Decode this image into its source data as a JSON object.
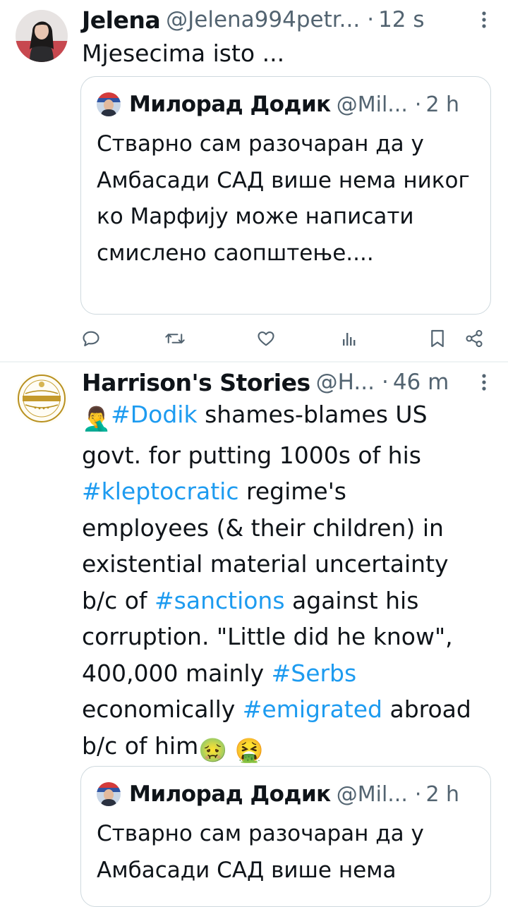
{
  "tweets": [
    {
      "author_name": "Jelena",
      "author_handle": "@Jelena994petr...",
      "time": "12 s",
      "text": "Mjesecima isto ...",
      "quote": {
        "author_name": "Милорад Додик",
        "author_handle": "@Mil...",
        "time": "2 h",
        "text": "Стварно сам разочаран да у Амбасади САД више нема никог ко Марфију може написати смислено саопштење...."
      }
    },
    {
      "author_name": "Harrison's Stories",
      "author_handle": "@H...",
      "time": "46 m",
      "text_segments": [
        {
          "t": "🤦‍♂️",
          "emoji": true
        },
        {
          "t": "#Dodik",
          "tag": true
        },
        {
          "t": " shames-blames US govt. for putting 1000s of his "
        },
        {
          "t": "#kleptocratic",
          "tag": true
        },
        {
          "t": " regime's employees (& their children) in existential material uncertainty b/c of "
        },
        {
          "t": "#sanctions",
          "tag": true
        },
        {
          "t": " against his corruption. \"Little did he know\", 400,000 mainly "
        },
        {
          "t": "#Serbs",
          "tag": true
        },
        {
          "t": " economically "
        },
        {
          "t": "#emigrated",
          "tag": true
        },
        {
          "t": " abroad b/c of him"
        },
        {
          "t": "🤢",
          "emoji": true
        },
        {
          "t": " "
        },
        {
          "t": "🤮",
          "emoji": true
        }
      ],
      "quote": {
        "author_name": "Милорад Додик",
        "author_handle": "@Mil...",
        "time": "2 h",
        "text": "Стварно сам разочаран да у Амбасади САД више нема"
      }
    }
  ],
  "separator": "·",
  "icons": {
    "more": "more-vertical-icon",
    "reply": "reply-icon",
    "retweet": "retweet-icon",
    "like": "heart-icon",
    "views": "analytics-icon",
    "bookmark": "bookmark-icon",
    "share": "share-icon"
  },
  "colors": {
    "hashtag": "#1d9bf0",
    "secondary_text": "#536471",
    "border": "#cfd9de",
    "icon": "#536471"
  }
}
